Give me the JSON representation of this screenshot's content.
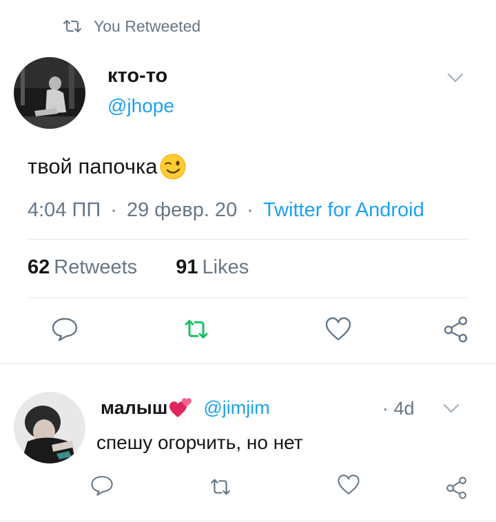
{
  "retweet_header": {
    "label": "You Retweeted",
    "icon": "retweet-icon"
  },
  "tweet": {
    "display_name": "кто-то",
    "handle": "@jhope",
    "text": "твой папочка",
    "emoji": "winking-face-emoji",
    "time": "4:04 ПП",
    "sep1": "·",
    "date": "29 февр. 20",
    "sep2": "·",
    "source": "Twitter for Android",
    "retweets_count": "62",
    "retweets_label": "Retweets",
    "likes_count": "91",
    "likes_label": "Likes"
  },
  "reply": {
    "display_name": "малыш",
    "emoji": "two-hearts-emoji",
    "handle": "@jimjim",
    "time": "· 4d",
    "text": "спешу огорчить, но нет"
  },
  "colors": {
    "accent": "#1da1f2",
    "retweet_active": "#17bf63",
    "muted": "#657786",
    "divider": "#e1e8ed"
  }
}
